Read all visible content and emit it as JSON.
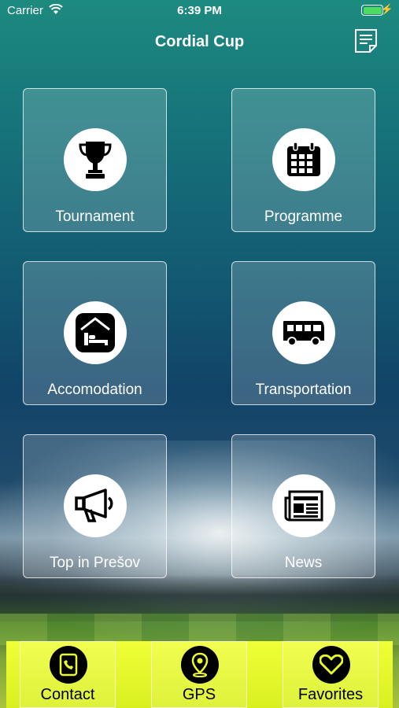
{
  "status_bar": {
    "carrier": "Carrier",
    "time": "6:39 PM"
  },
  "nav": {
    "title": "Cordial Cup",
    "notes_icon": "notes-icon"
  },
  "tiles": [
    {
      "label": "Tournament",
      "icon": "trophy-icon"
    },
    {
      "label": "Programme",
      "icon": "calendar-icon"
    },
    {
      "label": "Accomodation",
      "icon": "hotel-bed-icon"
    },
    {
      "label": "Transportation",
      "icon": "bus-icon"
    },
    {
      "label": "Top in Prešov",
      "icon": "megaphone-icon"
    },
    {
      "label": "News",
      "icon": "newspaper-icon"
    }
  ],
  "tabs": [
    {
      "label": "Contact",
      "icon": "phone-book-icon"
    },
    {
      "label": "GPS",
      "icon": "location-pin-icon"
    },
    {
      "label": "Favorites",
      "icon": "heart-icon"
    }
  ],
  "colors": {
    "tabbar_accent": "#e8fa2a",
    "tile_border": "#ffffff",
    "battery": "#4cd964"
  }
}
